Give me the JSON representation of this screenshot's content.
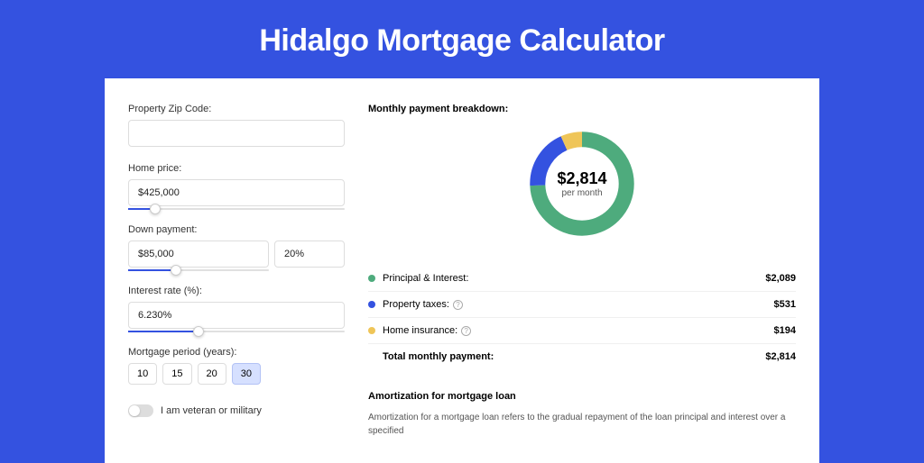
{
  "title": "Hidalgo Mortgage Calculator",
  "form": {
    "zip_label": "Property Zip Code:",
    "zip_value": "",
    "home_price_label": "Home price:",
    "home_price_value": "$425,000",
    "down_label": "Down payment:",
    "down_value": "$85,000",
    "down_pct": "20%",
    "rate_label": "Interest rate (%):",
    "rate_value": "6.230%",
    "period_label": "Mortgage period (years):",
    "periods": [
      "10",
      "15",
      "20",
      "30"
    ],
    "period_selected": "30",
    "veteran_label": "I am veteran or military"
  },
  "breakdown": {
    "title": "Monthly payment breakdown:",
    "center_amount": "$2,814",
    "center_sub": "per month",
    "rows": [
      {
        "label": "Principal & Interest:",
        "value": "$2,089",
        "color": "#4eab7d"
      },
      {
        "label": "Property taxes:",
        "value": "$531",
        "color": "#3452e0",
        "info": true
      },
      {
        "label": "Home insurance:",
        "value": "$194",
        "color": "#efc558",
        "info": true
      }
    ],
    "total_label": "Total monthly payment:",
    "total_value": "$2,814"
  },
  "chart_data": {
    "type": "pie",
    "title": "Monthly payment breakdown",
    "categories": [
      "Principal & Interest",
      "Property taxes",
      "Home insurance"
    ],
    "values": [
      2089,
      531,
      194
    ],
    "colors": [
      "#4eab7d",
      "#3452e0",
      "#efc558"
    ],
    "total": 2814
  },
  "amort": {
    "title": "Amortization for mortgage loan",
    "text": "Amortization for a mortgage loan refers to the gradual repayment of the loan principal and interest over a specified"
  }
}
